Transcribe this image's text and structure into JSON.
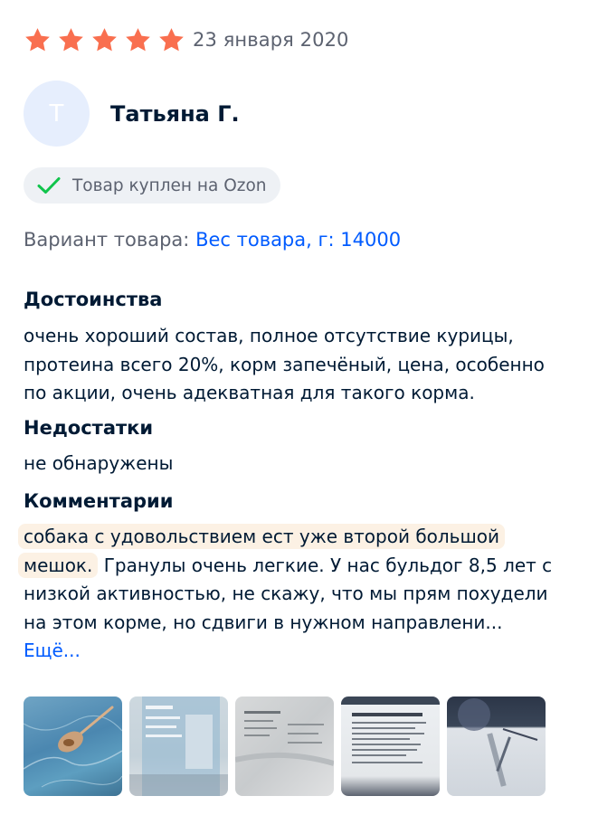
{
  "review": {
    "rating": 5,
    "rating_max": 5,
    "star_color": "#f96f4f",
    "date": "23 января 2020",
    "author": {
      "avatar_letter": "Т",
      "name": "Татьяна Г."
    },
    "purchase_badge": {
      "icon": "check-icon",
      "text": "Товар куплен на Ozon"
    },
    "variant": {
      "label": "Вариант товара:",
      "value": "Вес товара, г: 14000"
    },
    "pros": {
      "title": "Достоинства",
      "text": "очень хороший состав, полное отсутствие курицы, протеина всего 20%, корм запечёный, цена, особенно по акции, очень адекватная для такого корма."
    },
    "cons": {
      "title": "Недостатки",
      "text": "не обнаружены"
    },
    "comment": {
      "title": "Комментарии",
      "text_highlighted": "собака с удовольствием ест уже второй большой мешок.",
      "text_rest": "Гранулы очень легкие. У нас бульдог 8,5 лет с низкой активностью, не скажу, что мы прям похудели на этом корме, но сдвиги в нужном направлени...",
      "more_link": "Ещё..."
    },
    "photos": [
      {
        "alt": "photo-spoon-with-kibble"
      },
      {
        "alt": "photo-bag-back"
      },
      {
        "alt": "photo-bag-side"
      },
      {
        "alt": "photo-bag-label"
      },
      {
        "alt": "photo-bag-front"
      }
    ]
  },
  "colors": {
    "accent_link": "#005bff",
    "text_primary": "#001a34",
    "text_secondary": "#5c6270",
    "badge_check": "#10c44c",
    "highlight_bg": "#fcf1e4"
  }
}
